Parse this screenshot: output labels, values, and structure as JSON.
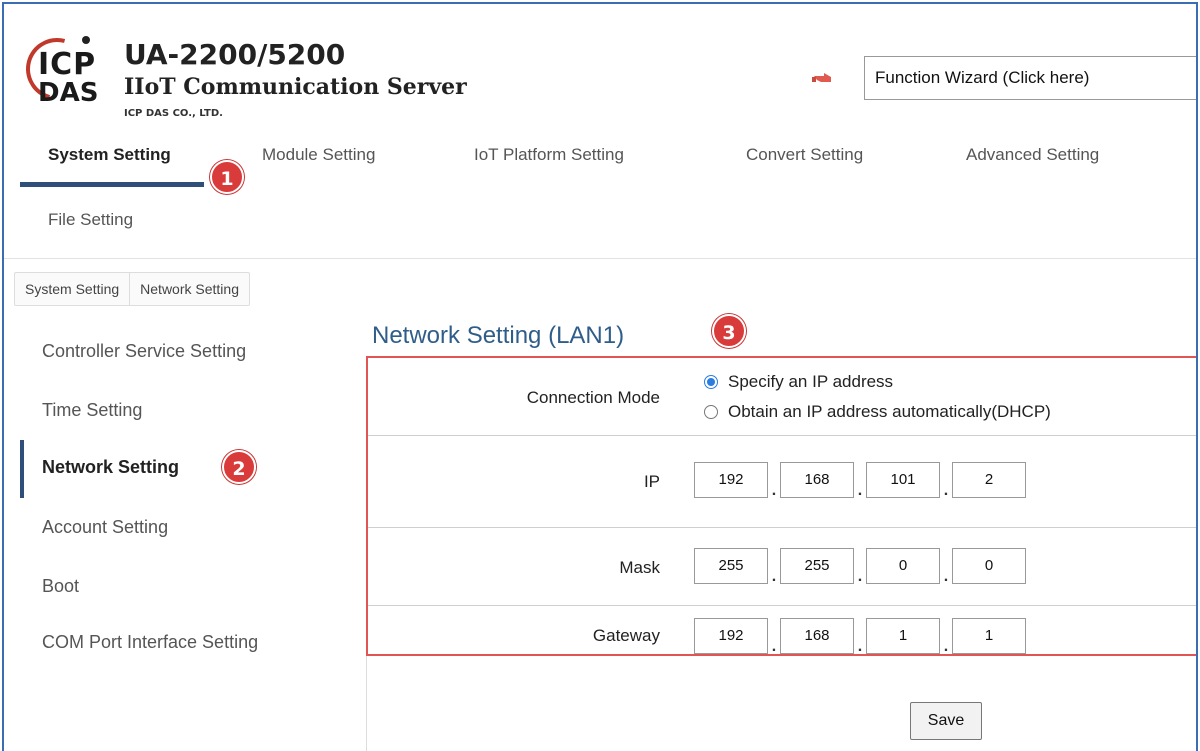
{
  "header": {
    "logo_top": "ICP",
    "logo_bottom": "DAS",
    "product_title": "UA-2200/5200",
    "product_subtitle": "IIoT Communication Server",
    "company": "ICP DAS CO., LTD.",
    "wizard_label": "Function Wizard (Click here)"
  },
  "top_menu": {
    "items": [
      {
        "label": "System Setting",
        "active": true
      },
      {
        "label": "Module Setting"
      },
      {
        "label": "IoT Platform Setting"
      },
      {
        "label": "Convert Setting"
      },
      {
        "label": "Advanced Setting"
      },
      {
        "label": "File Setting"
      }
    ]
  },
  "badges": [
    "1",
    "2",
    "3"
  ],
  "breadcrumb": [
    "System Setting",
    "Network Setting"
  ],
  "sidebar": {
    "items": [
      {
        "label": "Controller Service Setting"
      },
      {
        "label": "Time Setting"
      },
      {
        "label": "Network Setting",
        "active": true
      },
      {
        "label": "Account Setting"
      },
      {
        "label": "Boot"
      },
      {
        "label": "COM Port Interface Setting"
      }
    ]
  },
  "main": {
    "title": "Network Setting (LAN1)",
    "connection_mode": {
      "label": "Connection Mode",
      "options": [
        {
          "label": "Specify an IP address",
          "selected": true
        },
        {
          "label": "Obtain an IP address automatically(DHCP)",
          "selected": false
        }
      ]
    },
    "ip": {
      "label": "IP",
      "octets": [
        "192",
        "168",
        "101",
        "2"
      ]
    },
    "mask": {
      "label": "Mask",
      "octets": [
        "255",
        "255",
        "0",
        "0"
      ]
    },
    "gateway": {
      "label": "Gateway",
      "octets": [
        "192",
        "168",
        "1",
        "1"
      ]
    },
    "save_label": "Save"
  },
  "colors": {
    "accent": "#2f4f7a",
    "badge": "#d93a3a",
    "highlight_border": "#e25555",
    "title": "#2f5d8a",
    "radio_selected": "#2a7de1"
  }
}
